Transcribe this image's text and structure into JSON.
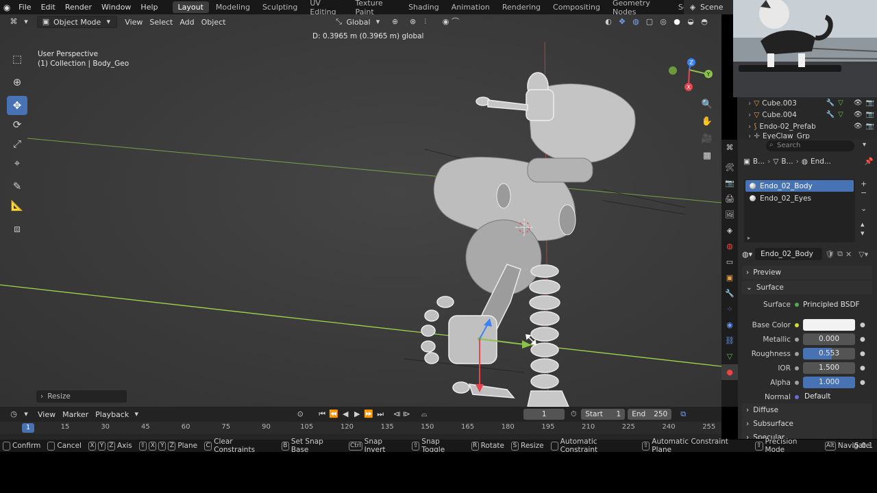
{
  "colors": {
    "accent": "#4772b3",
    "x_axis": "#e8434f",
    "y_axis": "#8bc34a",
    "z_axis": "#3b82f6",
    "active_frame": "#4772b3"
  },
  "menubar": {
    "items": [
      "File",
      "Edit",
      "Render",
      "Window",
      "Help"
    ],
    "workspaces": [
      "Layout",
      "Modeling",
      "Sculpting",
      "UV Editing",
      "Texture Paint",
      "Shading",
      "Animation",
      "Rendering",
      "Compositing",
      "Geometry Nodes",
      "Scripting"
    ],
    "active_workspace": "Layout",
    "add_tab": "+",
    "scene": "Scene"
  },
  "viewport": {
    "mode": "Object Mode",
    "menus": [
      "View",
      "Select",
      "Add",
      "Object"
    ],
    "transform_orientation": "Global",
    "info_line1": "User Perspective",
    "info_line2": "(1) Collection | Body_Geo",
    "distance_readout": "D: 0.3965 m (0.3965 m) global",
    "last_operator": "Resize",
    "gizmo": {
      "x": "X",
      "y": "Y",
      "z": "Z"
    }
  },
  "outliner": {
    "rows": [
      {
        "label": "Cube.003",
        "icon": "mesh-icon"
      },
      {
        "label": "Cube.004",
        "icon": "mesh-icon"
      },
      {
        "label": "Endo-02_Prefab",
        "icon": "armature-icon"
      },
      {
        "label": "EyeClaw_Grp",
        "icon": "empty-icon"
      }
    ]
  },
  "properties": {
    "search_placeholder": "Search",
    "breadcrumb": [
      "B...",
      "B...",
      "End..."
    ],
    "material_slots": [
      "Endo_02_Body",
      "Endo_02_Eyes"
    ],
    "selected_slot": "Endo_02_Body",
    "material_name": "Endo_02_Body",
    "panels": {
      "preview": "Preview",
      "surface": "Surface",
      "diffuse": "Diffuse",
      "subsurface": "Subsurface",
      "specular": "Specular"
    },
    "surface_label": "Surface",
    "surface_shader": "Principled BSDF",
    "fields": [
      {
        "label": "Base Color",
        "value": "",
        "kind": "color",
        "color": "#f2f2f2"
      },
      {
        "label": "Metallic",
        "value": "0.000",
        "fraction": 0.0
      },
      {
        "label": "Roughness",
        "value": "0.553",
        "fraction": 0.553
      },
      {
        "label": "IOR",
        "value": "1.500",
        "fraction": 1.0
      },
      {
        "label": "Alpha",
        "value": "1.000",
        "fraction": 1.0
      },
      {
        "label": "Normal",
        "value": "Default",
        "kind": "link"
      }
    ]
  },
  "timeline": {
    "menus": [
      "View",
      "Marker",
      "Playback"
    ],
    "current_frame": "1",
    "start_label": "Start",
    "start": "1",
    "end_label": "End",
    "end": "250",
    "ruler": [
      "1",
      "15",
      "30",
      "45",
      "60",
      "75",
      "90",
      "105",
      "120",
      "135",
      "150",
      "165",
      "180",
      "195",
      "210",
      "225",
      "240",
      "255"
    ]
  },
  "statusbar": {
    "items": [
      {
        "keys": [
          ""
        ],
        "label": "Confirm"
      },
      {
        "keys": [
          ""
        ],
        "label": "Cancel"
      },
      {
        "keys": [
          "X",
          "Y",
          "Z"
        ],
        "label": "Axis"
      },
      {
        "keys": [
          "⇧",
          "X",
          "Y",
          "Z"
        ],
        "label": "Plane"
      },
      {
        "keys": [
          "C"
        ],
        "label": "Clear Constraints"
      },
      {
        "keys": [
          "B"
        ],
        "label": "Set Snap Base"
      },
      {
        "keys": [
          "Ctrl"
        ],
        "label": "Snap Invert"
      },
      {
        "keys": [
          "⇧"
        ],
        "label": "Snap Toggle"
      },
      {
        "keys": [
          "R"
        ],
        "label": "Rotate"
      },
      {
        "keys": [
          "S"
        ],
        "label": "Resize"
      },
      {
        "keys": [
          ""
        ],
        "label": "Automatic Constraint"
      },
      {
        "keys": [
          "⇧"
        ],
        "label": "Automatic Constraint Plane"
      },
      {
        "keys": [
          "⇧"
        ],
        "label": "Precision Mode"
      },
      {
        "keys": [
          "Alt"
        ],
        "label": "Navigate"
      }
    ],
    "version": "5.0.1"
  }
}
